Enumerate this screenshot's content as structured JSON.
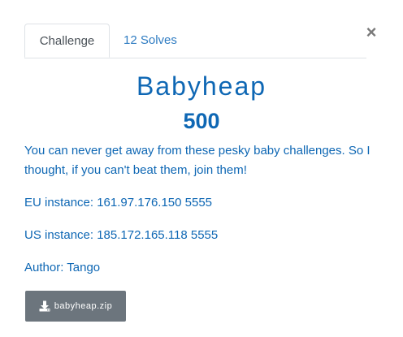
{
  "modal": {
    "close_glyph": "×"
  },
  "tabs": [
    {
      "label": "Challenge",
      "active": true
    },
    {
      "label": "12 Solves",
      "active": false
    }
  ],
  "challenge": {
    "name": "Babyheap",
    "points": "500",
    "description": "You can never get away from these pesky baby challenges. So I thought, if you can't beat them, join them!",
    "eu_instance": "EU instance: 161.97.176.150 5555",
    "us_instance": "US instance: 185.172.165.118 5555",
    "author": "Author: Tango"
  },
  "download": {
    "icon": "download-icon",
    "label": "babyheap.zip"
  },
  "colors": {
    "primary": "#0e67b4",
    "link": "#2f7cc2",
    "button_bg": "#6c757d",
    "tab_border": "#dee2e6"
  }
}
